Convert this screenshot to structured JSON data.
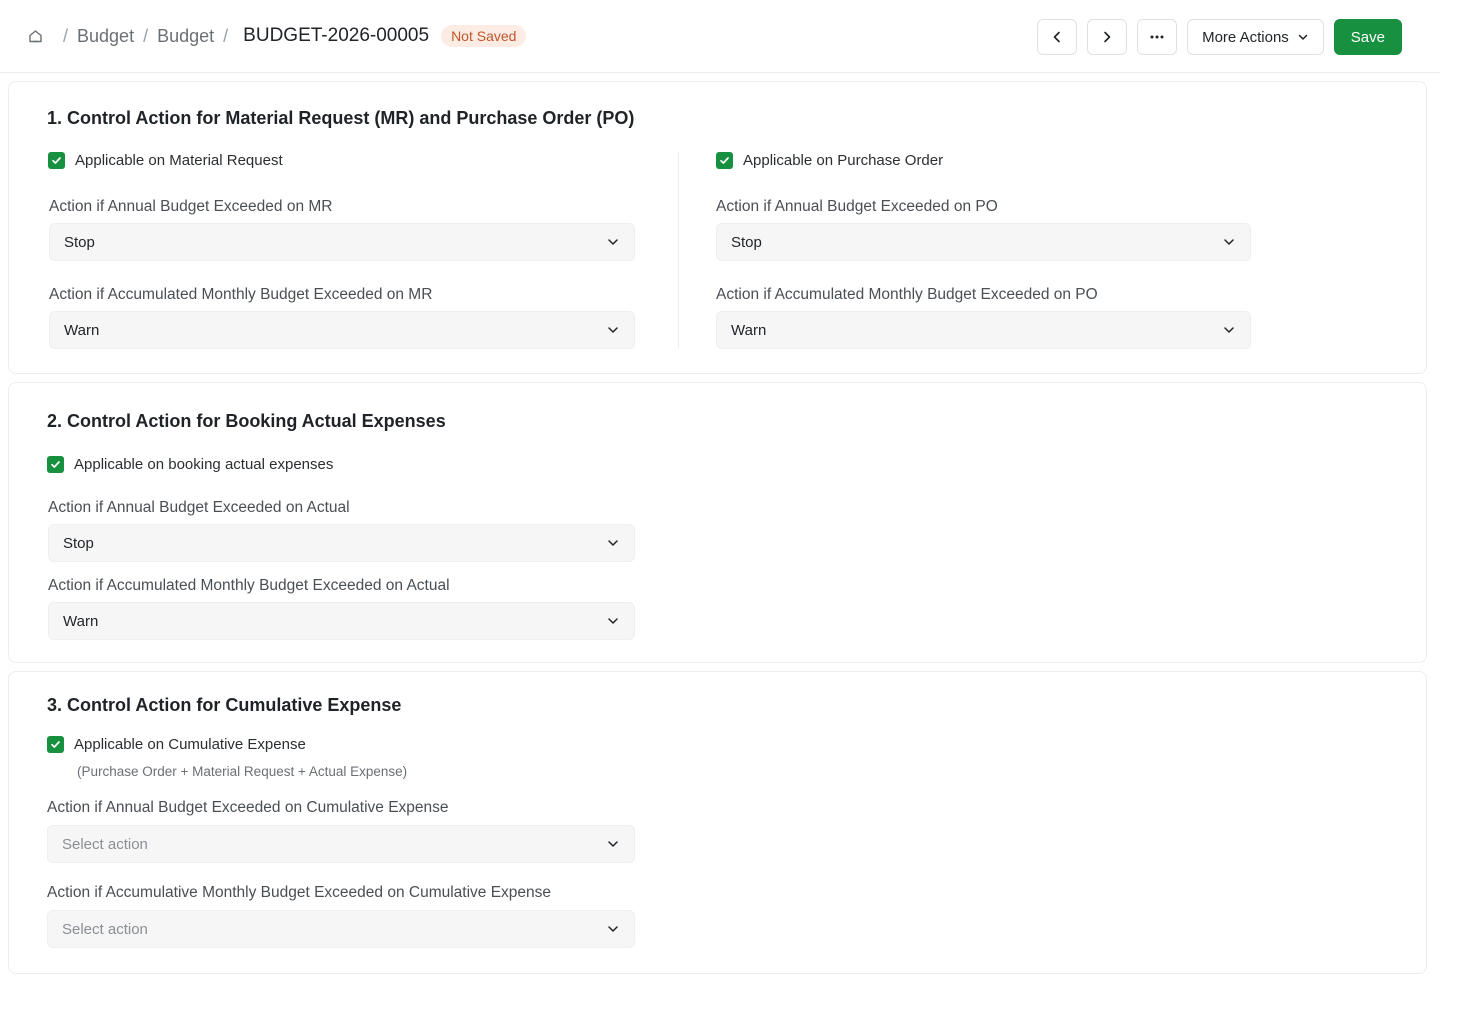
{
  "breadcrumb": {
    "items": [
      "Budget",
      "Budget"
    ],
    "current": "BUDGET-2026-00005",
    "status": "Not Saved"
  },
  "toolbar": {
    "more_actions_label": "More Actions",
    "save_label": "Save",
    "ellipsis": "···"
  },
  "section1": {
    "title": "1.  Control Action for Material Request (MR) and Purchase Order (PO)",
    "mr": {
      "checkbox_label": "Applicable on Material Request",
      "annual_label": "Action if Annual Budget Exceeded on MR",
      "annual_value": "Stop",
      "monthly_label": "Action if Accumulated Monthly Budget Exceeded on MR",
      "monthly_value": "Warn"
    },
    "po": {
      "checkbox_label": "Applicable on Purchase Order",
      "annual_label": "Action if Annual Budget Exceeded on PO",
      "annual_value": "Stop",
      "monthly_label": "Action if Accumulated Monthly Budget Exceeded on PO",
      "monthly_value": "Warn"
    }
  },
  "section2": {
    "title": "2. Control Action for Booking Actual Expenses",
    "checkbox_label": "Applicable on booking actual expenses",
    "annual_label": "Action if Annual Budget Exceeded on Actual",
    "annual_value": "Stop",
    "monthly_label": "Action if Accumulated Monthly Budget Exceeded on Actual",
    "monthly_value": "Warn"
  },
  "section3": {
    "title": "3. Control Action for Cumulative Expense",
    "checkbox_label": "Applicable on Cumulative Expense",
    "hint": "(Purchase Order + Material Request + Actual Expense)",
    "annual_label": "Action if Annual Budget Exceeded on Cumulative Expense",
    "annual_placeholder": "Select action",
    "monthly_label": "Action if Accumulative Monthly Budget Exceeded on Cumulative Expense",
    "monthly_placeholder": "Select action"
  },
  "colors": {
    "accent_green": "#17913f",
    "badge_bg": "#fdece4",
    "badge_text": "#c2552a"
  }
}
